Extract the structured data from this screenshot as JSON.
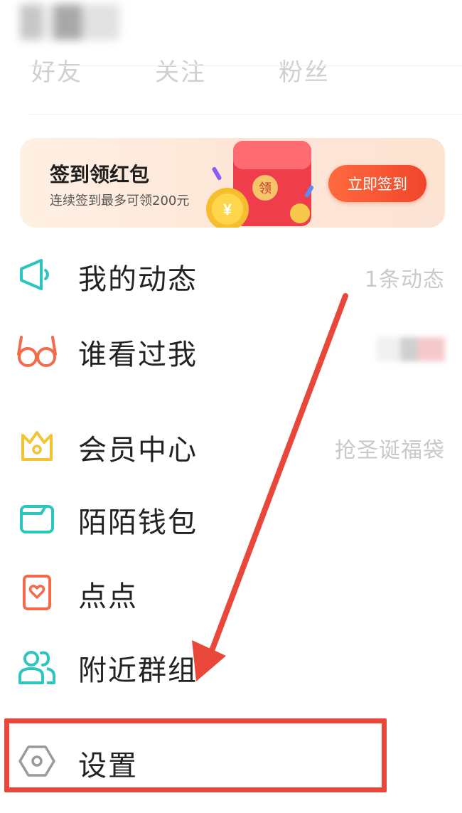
{
  "stats": {
    "friends": "好友",
    "following": "关注",
    "fans": "粉丝"
  },
  "banner": {
    "title": "签到领红包",
    "subtitle": "连续签到最多可领200元",
    "envelope_text": "领",
    "coin_text": "¥",
    "button": "立即签到"
  },
  "menu": [
    {
      "label": "我的动态",
      "right": "1条动态",
      "icon": "megaphone-icon"
    },
    {
      "label": "谁看过我",
      "right": "",
      "icon": "glasses-icon"
    },
    {
      "label": "会员中心",
      "right": "抢圣诞福袋",
      "icon": "crown-icon"
    },
    {
      "label": "陌陌钱包",
      "right": "",
      "icon": "wallet-icon"
    },
    {
      "label": "点点",
      "right": "",
      "icon": "heart-card-icon"
    },
    {
      "label": "附近群组",
      "right": "",
      "icon": "group-icon"
    },
    {
      "label": "设置",
      "right": "",
      "icon": "settings-hexagon-icon"
    }
  ],
  "colors": {
    "accent_red": "#e9473a",
    "teal": "#2bc6bf",
    "orange": "#f36b4a",
    "yellow": "#f3c431"
  }
}
